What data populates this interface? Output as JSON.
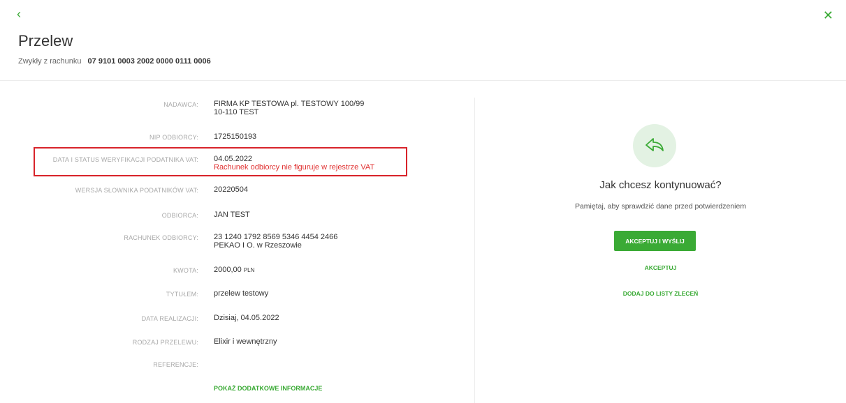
{
  "nav": {
    "back_icon": "‹",
    "close_icon": "✕"
  },
  "header": {
    "title": "Przelew",
    "subtitle_label": "Zwykły z rachunku",
    "account_number": "07 9101 0003 2002 0000 0111 0006"
  },
  "details": {
    "sender": {
      "label": "NADAWCA:",
      "line1": "FIRMA KP TESTOWA pl. TESTOWY 100/99",
      "line2": "10-110 TEST"
    },
    "nip": {
      "label": "NIP ODBIORCY:",
      "value": "1725150193"
    },
    "vat_status": {
      "label": "DATA I STATUS WERYFIKACJI PODATNIKA VAT:",
      "line1": "04.05.2022",
      "line2": "Rachunek odbiorcy nie figuruje w rejestrze VAT"
    },
    "dictionary_version": {
      "label": "WERSJA SŁOWNIKA PODATNIKÓW VAT:",
      "value": "20220504"
    },
    "recipient": {
      "label": "ODBIORCA:",
      "value": "JAN TEST"
    },
    "recipient_account": {
      "label": "RACHUNEK ODBIORCY:",
      "line1": "23 1240 1792 8569 5346 4454 2466",
      "line2": "PEKAO I O. w Rzeszowie"
    },
    "amount": {
      "label": "KWOTA:",
      "value": "2000,00",
      "currency": "PLN"
    },
    "title": {
      "label": "TYTUŁEM:",
      "value": "przelew testowy"
    },
    "execution_date": {
      "label": "DATA REALIZACJI:",
      "value": "Dzisiaj, 04.05.2022"
    },
    "transfer_type": {
      "label": "RODZAJ PRZELEWU:",
      "value": "Elixir i wewnętrzny"
    },
    "references": {
      "label": "REFERENCJE:",
      "value": ""
    },
    "show_more": "POKAŻ DODATKOWE INFORMACJE"
  },
  "actions": {
    "icon": "send-arrow-icon",
    "question": "Jak chcesz kontynuować?",
    "hint": "Pamiętaj, aby sprawdzić dane przed potwierdzeniem",
    "accept_send": "AKCEPTUJ I WYŚLIJ",
    "accept": "AKCEPTUJ",
    "add_to_list": "DODAJ DO LISTY ZLECEŃ"
  },
  "colors": {
    "accent": "#3aaa35",
    "error": "#e03030",
    "highlight_border": "#d8232a"
  }
}
